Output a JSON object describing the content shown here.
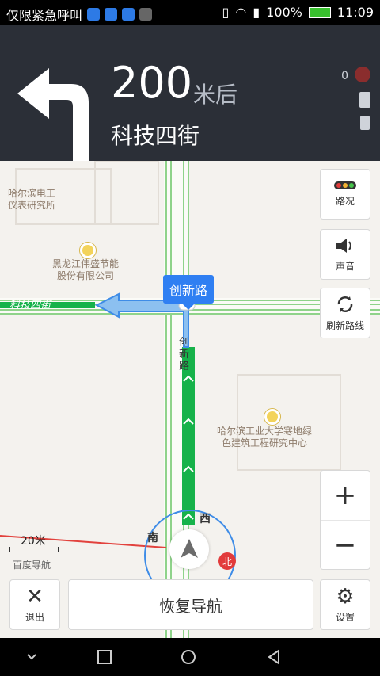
{
  "status": {
    "left_text": "仅限紧急呼叫",
    "battery": "100%",
    "time": "11:09"
  },
  "guidance": {
    "distance_value": "200",
    "distance_unit": "米后",
    "road_name": "科技四街",
    "gps_satellites": "0"
  },
  "map": {
    "road_callout": "创新路",
    "street_name_horizontal": "科技四街",
    "street_name_vertical": "创新路",
    "pois": [
      {
        "label": "哈尔滨电工\n仪表研究所"
      },
      {
        "label": "黑龙江伟盛节能\n股份有限公司"
      },
      {
        "label": "哈尔滨工业大学寒地绿\n色建筑工程研究中心"
      }
    ],
    "scale": "20米",
    "watermark": "百度导航",
    "compass": {
      "west": "西",
      "south": "南",
      "north": "北"
    }
  },
  "buttons": {
    "traffic": "路况",
    "sound": "声音",
    "refresh_route": "刷新路线",
    "exit": "退出",
    "resume_navigation": "恢复导航",
    "settings": "设置"
  },
  "colors": {
    "header_bg": "#2b2f37",
    "route_green": "#16b24a",
    "route_blue": "#3e8ce7",
    "callout_blue": "#2f7ff2"
  }
}
